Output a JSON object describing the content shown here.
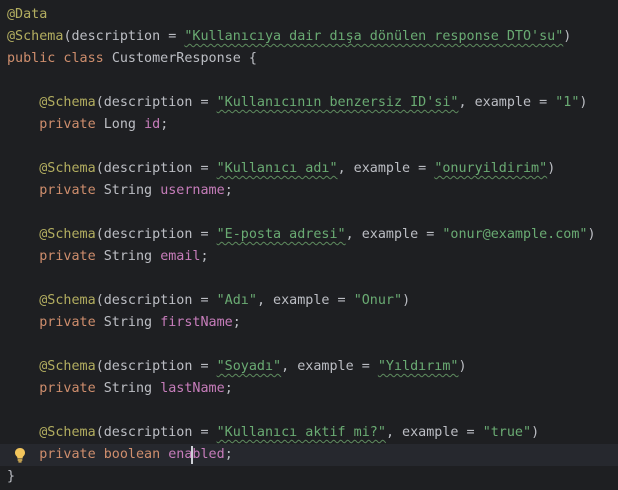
{
  "theme": {
    "background": "#1e1f22",
    "active_line": "#26282e",
    "annotation": "#b3ae60",
    "keyword": "#cf8e6d",
    "string": "#6aab73",
    "field": "#c77dbb",
    "text": "#bcbec4",
    "intention_bulb": "#f2c55c"
  },
  "editor": {
    "intention_icon": "lightbulb-icon",
    "active_line_index": 20
  },
  "code": {
    "lines": [
      [
        {
          "t": "annotation",
          "v": "@Data"
        }
      ],
      [
        {
          "t": "annotation",
          "v": "@Schema"
        },
        {
          "t": "punct",
          "v": "(description = "
        },
        {
          "t": "string",
          "v": "\"Kullanıcıya dair dışa dönülen response DTO'su\"",
          "sq": true
        },
        {
          "t": "punct",
          "v": ")"
        }
      ],
      [
        {
          "t": "keyword",
          "v": "public class "
        },
        {
          "t": "punct",
          "v": "CustomerResponse {"
        }
      ],
      [],
      [
        {
          "t": "punct",
          "v": "    "
        },
        {
          "t": "annotation",
          "v": "@Schema"
        },
        {
          "t": "punct",
          "v": "(description = "
        },
        {
          "t": "string",
          "v": "\"Kullanıcının benzersiz ID'si\"",
          "sq": true
        },
        {
          "t": "punct",
          "v": ", example = "
        },
        {
          "t": "string",
          "v": "\"1\""
        },
        {
          "t": "punct",
          "v": ")"
        }
      ],
      [
        {
          "t": "punct",
          "v": "    "
        },
        {
          "t": "keyword",
          "v": "private "
        },
        {
          "t": "punct",
          "v": "Long "
        },
        {
          "t": "field",
          "v": "id"
        },
        {
          "t": "punct",
          "v": ";"
        }
      ],
      [],
      [
        {
          "t": "punct",
          "v": "    "
        },
        {
          "t": "annotation",
          "v": "@Schema"
        },
        {
          "t": "punct",
          "v": "(description = "
        },
        {
          "t": "string",
          "v": "\"Kullanıcı adı\"",
          "sq": true
        },
        {
          "t": "punct",
          "v": ", example = "
        },
        {
          "t": "string",
          "v": "\"onuryildirim\"",
          "sq": true
        },
        {
          "t": "punct",
          "v": ")"
        }
      ],
      [
        {
          "t": "punct",
          "v": "    "
        },
        {
          "t": "keyword",
          "v": "private "
        },
        {
          "t": "punct",
          "v": "String "
        },
        {
          "t": "field",
          "v": "username"
        },
        {
          "t": "punct",
          "v": ";"
        }
      ],
      [],
      [
        {
          "t": "punct",
          "v": "    "
        },
        {
          "t": "annotation",
          "v": "@Schema"
        },
        {
          "t": "punct",
          "v": "(description = "
        },
        {
          "t": "string",
          "v": "\"E-posta adresi\"",
          "sq": true
        },
        {
          "t": "punct",
          "v": ", example = "
        },
        {
          "t": "string",
          "v": "\"onur@example.com\""
        },
        {
          "t": "punct",
          "v": ")"
        }
      ],
      [
        {
          "t": "punct",
          "v": "    "
        },
        {
          "t": "keyword",
          "v": "private "
        },
        {
          "t": "punct",
          "v": "String "
        },
        {
          "t": "field",
          "v": "email"
        },
        {
          "t": "punct",
          "v": ";"
        }
      ],
      [],
      [
        {
          "t": "punct",
          "v": "    "
        },
        {
          "t": "annotation",
          "v": "@Schema"
        },
        {
          "t": "punct",
          "v": "(description = "
        },
        {
          "t": "string",
          "v": "\"Adı\""
        },
        {
          "t": "punct",
          "v": ", example = "
        },
        {
          "t": "string",
          "v": "\"Onur\""
        },
        {
          "t": "punct",
          "v": ")"
        }
      ],
      [
        {
          "t": "punct",
          "v": "    "
        },
        {
          "t": "keyword",
          "v": "private "
        },
        {
          "t": "punct",
          "v": "String "
        },
        {
          "t": "field",
          "v": "firstName"
        },
        {
          "t": "punct",
          "v": ";"
        }
      ],
      [],
      [
        {
          "t": "punct",
          "v": "    "
        },
        {
          "t": "annotation",
          "v": "@Schema"
        },
        {
          "t": "punct",
          "v": "(description = "
        },
        {
          "t": "string",
          "v": "\"Soyadı\"",
          "sq": true
        },
        {
          "t": "punct",
          "v": ", example = "
        },
        {
          "t": "string",
          "v": "\"Yıldırım\"",
          "sq": true
        },
        {
          "t": "punct",
          "v": ")"
        }
      ],
      [
        {
          "t": "punct",
          "v": "    "
        },
        {
          "t": "keyword",
          "v": "private "
        },
        {
          "t": "punct",
          "v": "String "
        },
        {
          "t": "field",
          "v": "lastName"
        },
        {
          "t": "punct",
          "v": ";"
        }
      ],
      [],
      [
        {
          "t": "punct",
          "v": "    "
        },
        {
          "t": "annotation",
          "v": "@Schema"
        },
        {
          "t": "punct",
          "v": "(description = "
        },
        {
          "t": "string",
          "v": "\"Kullanıcı aktif mi?\"",
          "sq": true
        },
        {
          "t": "punct",
          "v": ", example = "
        },
        {
          "t": "string",
          "v": "\"true\""
        },
        {
          "t": "punct",
          "v": ")"
        }
      ],
      [
        {
          "t": "punct",
          "v": "    "
        },
        {
          "t": "keyword",
          "v": "private boolean "
        },
        {
          "t": "field",
          "v": "enabled"
        },
        {
          "t": "punct",
          "v": ";"
        }
      ],
      [
        {
          "t": "punct",
          "v": "}"
        }
      ]
    ]
  }
}
